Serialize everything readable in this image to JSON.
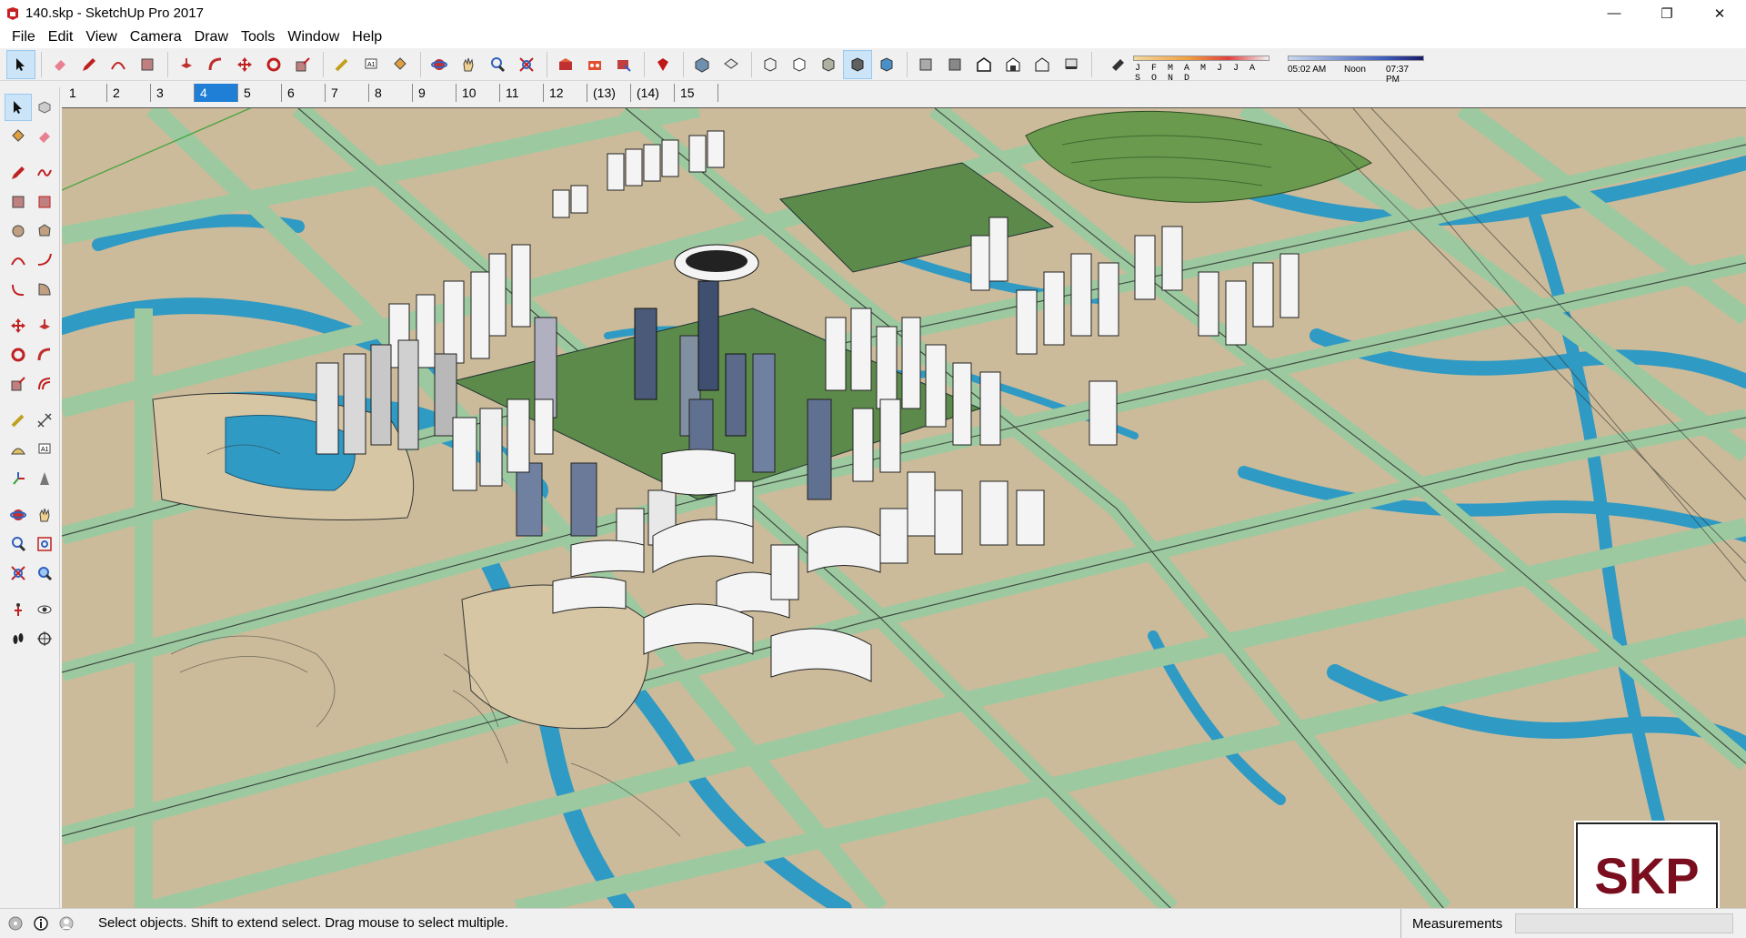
{
  "window": {
    "title": "140.skp - SketchUp Pro 2017",
    "app_icon": "sketchup-logo-icon",
    "controls": [
      "minimize-icon",
      "restore-icon",
      "close-icon"
    ],
    "minimize_glyph": "—",
    "restore_glyph": "❐",
    "close_glyph": "✕"
  },
  "menu": {
    "items": [
      "File",
      "Edit",
      "View",
      "Camera",
      "Draw",
      "Tools",
      "Window",
      "Help"
    ]
  },
  "toolbar": {
    "tools": [
      "select-icon",
      "eraser-icon",
      "pencil-icon",
      "arc-icon",
      "rectangle-icon",
      "pushpull-icon",
      "followme-icon",
      "move-icon",
      "rotate-icon",
      "scale-icon",
      "tape-icon",
      "text-icon",
      "paint-bucket-icon",
      "orbit-icon",
      "pan-icon",
      "zoom-icon",
      "zoom-extents-icon",
      "warehouse-icon",
      "extension-icon",
      "send-icon",
      "ruby-icon",
      "iso-view-icon",
      "top-view-icon",
      "front-view-icon",
      "right-view-icon",
      "back-view-icon",
      "left-view-icon",
      "xray-icon",
      "wireframe-icon",
      "hidden-line-icon",
      "shaded-icon",
      "shaded-texture-icon",
      "monochrome-icon",
      "shadow-toggle-icon"
    ],
    "shadow_months": "J F M A M J J A S O N D",
    "shadow_times": [
      "05:02 AM",
      "Noon",
      "07:37 PM"
    ]
  },
  "scenes": {
    "tabs": [
      "1",
      "2",
      "3",
      "4",
      "5",
      "6",
      "7",
      "8",
      "9",
      "10",
      "11",
      "12",
      "(13)",
      "(14)",
      "15"
    ],
    "active": "4"
  },
  "left_tools": [
    "select-icon",
    "make-component-icon",
    "paint-bucket-icon",
    "eraser-icon",
    "line-icon",
    "freehand-icon",
    "rectangle-icon",
    "rotated-rectangle-icon",
    "circle-icon",
    "polygon-icon",
    "arc-icon",
    "two-point-arc-icon",
    "three-point-arc-icon",
    "pie-icon",
    "move-icon",
    "pushpull-icon",
    "rotate-icon",
    "followme-icon",
    "scale-icon",
    "offset-icon",
    "tape-measure-icon",
    "dimension-icon",
    "protractor-icon",
    "text-icon",
    "axes-icon",
    "3d-text-icon",
    "orbit-icon",
    "pan-icon",
    "zoom-icon",
    "zoom-window-icon",
    "zoom-extents-icon",
    "previous-view-icon",
    "position-camera-icon",
    "look-around-icon",
    "walk-icon",
    "section-plane-icon"
  ],
  "colors": {
    "ground": "#cbbb9a",
    "road": "#9dc9a0",
    "water": "#2f9ac4",
    "park": "#5c8a4a",
    "building": "#f4f4f4",
    "selection_blue": "#cce4f7",
    "logo_red": "#7a0e1e"
  },
  "logo": {
    "text": "SKP"
  },
  "statusbar": {
    "icons": [
      "geo-location-icon",
      "info-icon",
      "user-icon"
    ],
    "message": "Select objects. Shift to extend select. Drag mouse to select multiple.",
    "measurements_label": "Measurements",
    "measurements_value": ""
  }
}
